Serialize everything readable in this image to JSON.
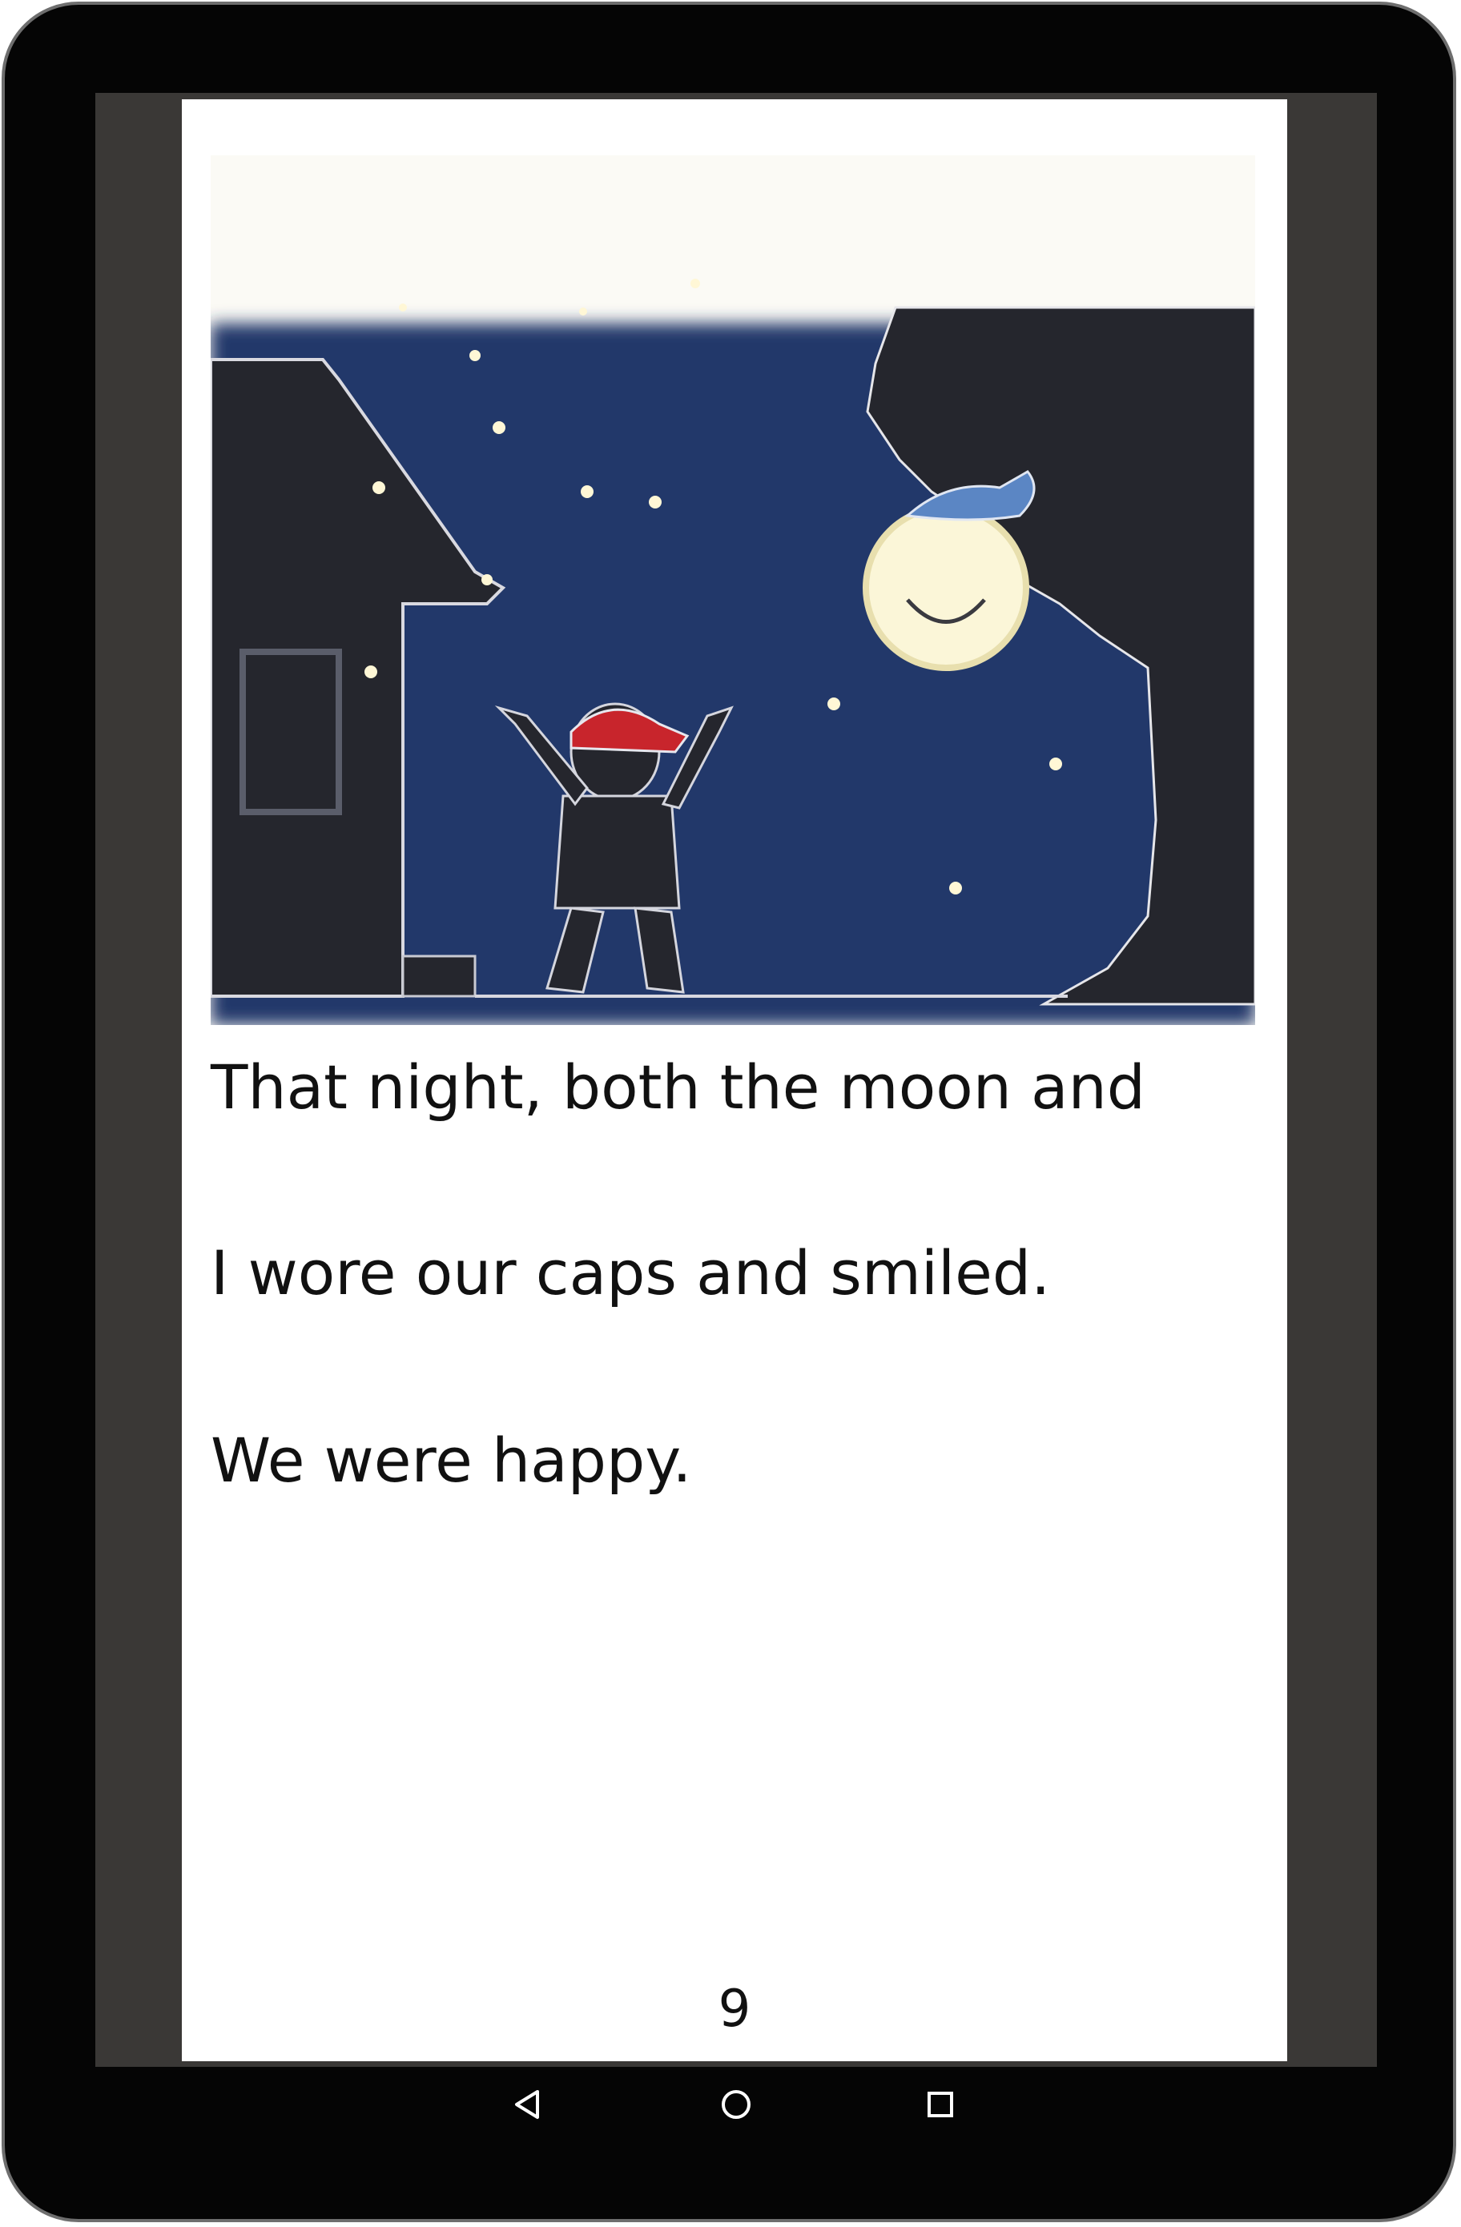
{
  "book": {
    "story_lines": [
      "That night, both the moon and",
      "I wore our caps and smiled.",
      "We were happy."
    ],
    "page_number": "9"
  },
  "navigation": {
    "back_icon": "back-triangle-icon",
    "home_icon": "home-circle-icon",
    "recent_icon": "recent-apps-square-icon"
  },
  "colors": {
    "night_sky": "#22396a",
    "moon": "#fbf6d8",
    "silhouette": "#25262d",
    "cap_red": "#c8252c",
    "device_frame": "#050505",
    "screen_bezel": "#3a3836"
  }
}
